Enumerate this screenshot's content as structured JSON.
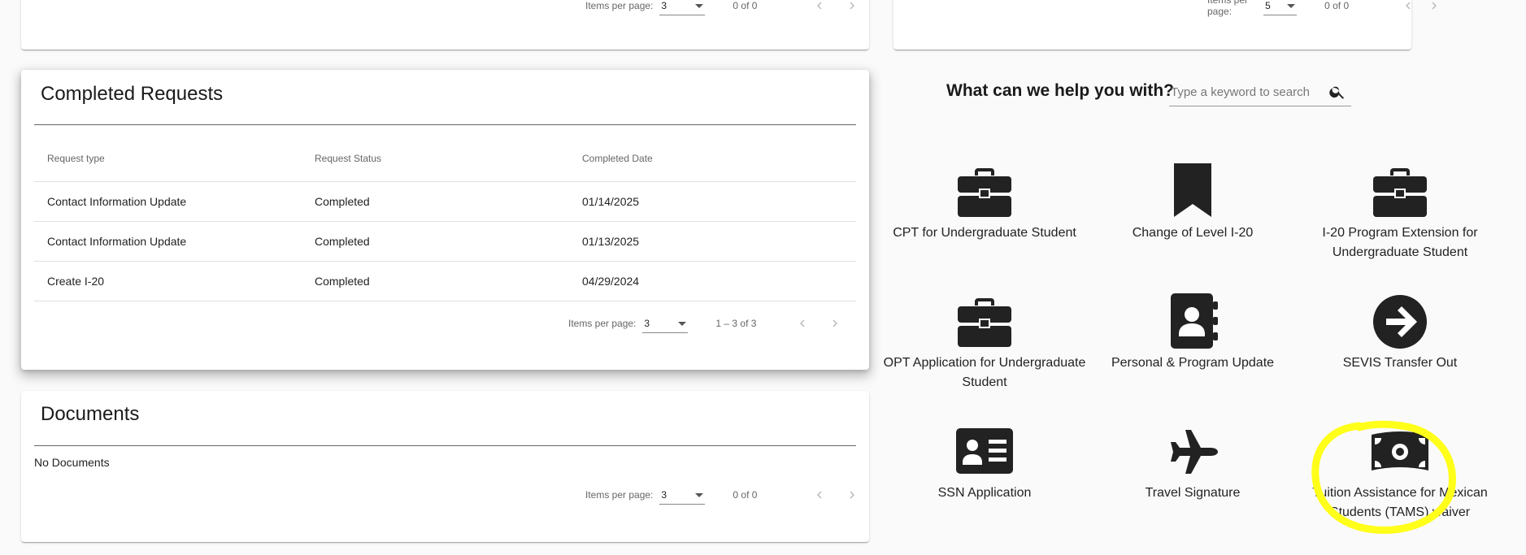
{
  "top_left_card": {
    "paginator": {
      "label": "Items per page:",
      "value": "3",
      "range": "0 of 0"
    }
  },
  "top_right_card": {
    "paginator": {
      "label": "Items per page:",
      "value": "5",
      "range": "0 of 0"
    }
  },
  "completed_requests": {
    "title": "Completed Requests",
    "headers": [
      "Request type",
      "Request Status",
      "Completed Date"
    ],
    "rows": [
      [
        "Contact Information Update",
        "Completed",
        "01/14/2025"
      ],
      [
        "Contact Information Update",
        "Completed",
        "01/13/2025"
      ],
      [
        "Create I-20",
        "Completed",
        "04/29/2024"
      ]
    ],
    "paginator": {
      "label": "Items per page:",
      "value": "3",
      "range": "1 – 3 of 3"
    }
  },
  "documents": {
    "title": "Documents",
    "empty_text": "No Documents",
    "paginator": {
      "label": "Items per page:",
      "value": "3",
      "range": "0 of 0"
    }
  },
  "help": {
    "title": "What can we help you with?",
    "search_placeholder": "Type a keyword to search"
  },
  "services": [
    {
      "label": "CPT for Undergraduate Student",
      "icon": "briefcase-icon"
    },
    {
      "label": "Change of Level I-20",
      "icon": "bookmark-icon"
    },
    {
      "label": "I-20 Program Extension for Undergraduate Student",
      "icon": "briefcase-icon"
    },
    {
      "label": "OPT Application for Undergraduate Student",
      "icon": "briefcase-icon"
    },
    {
      "label": "Personal & Program Update",
      "icon": "contact-book-icon"
    },
    {
      "label": "SEVIS Transfer Out",
      "icon": "arrow-circle-right-icon"
    },
    {
      "label": "SSN Application",
      "icon": "id-card-icon"
    },
    {
      "label": "Travel Signature",
      "icon": "airplane-icon"
    },
    {
      "label": "Tuition Assistance for Mexican Students (TAMS) waiver",
      "icon": "money-bill-icon"
    }
  ],
  "colors": {
    "icon": "#222222",
    "highlight": "#ffff1a",
    "divider": "#e0e0e0"
  }
}
